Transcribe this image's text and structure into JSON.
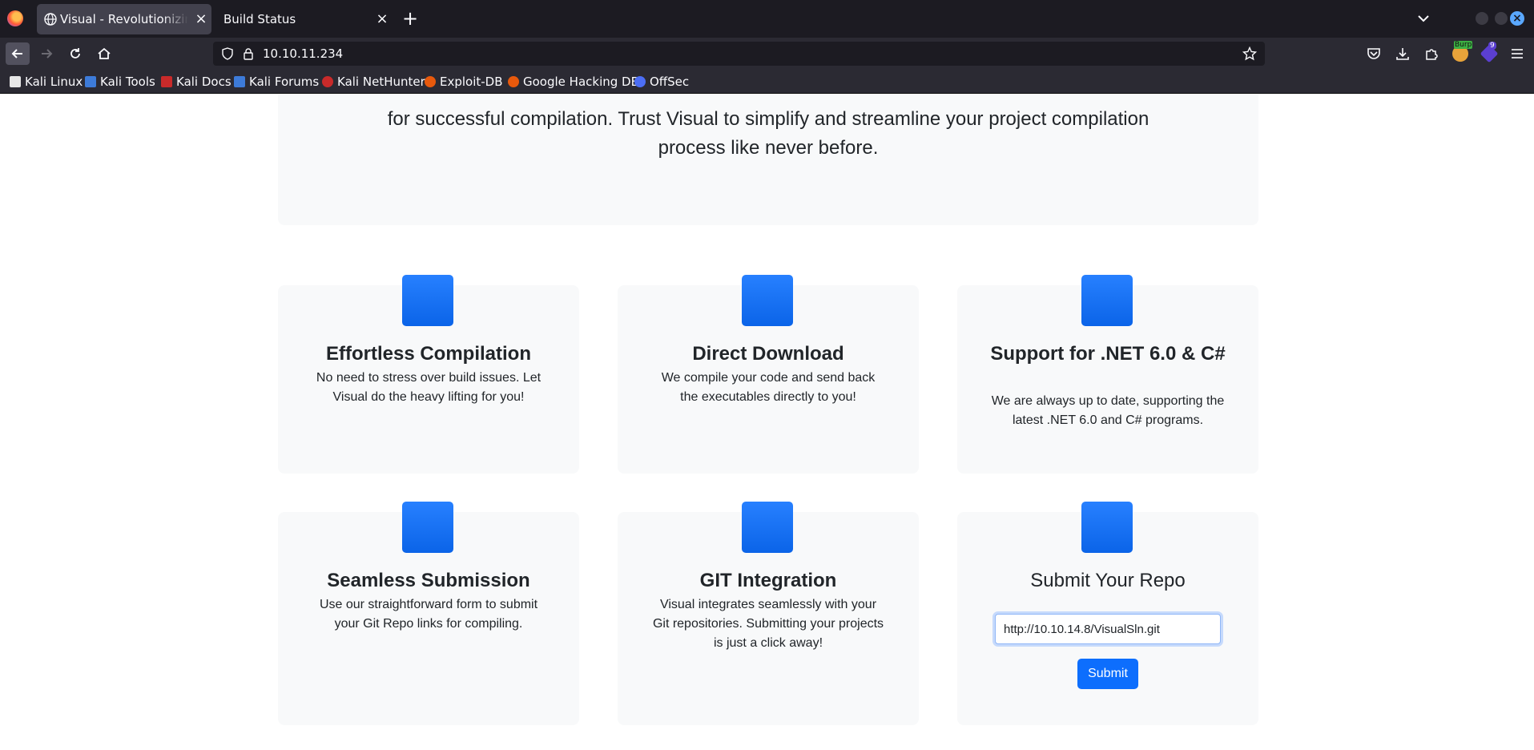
{
  "browser": {
    "tabs": [
      {
        "label": "Visual - Revolutionizing V",
        "active": true
      },
      {
        "label": "Build Status",
        "active": false
      }
    ],
    "url": "10.10.11.234",
    "bookmarks": [
      {
        "label": "Kali Linux",
        "icon": "kali-dragon-icon",
        "color": "#e6e6e6"
      },
      {
        "label": "Kali Tools",
        "icon": "kali-tools-icon",
        "color": "#3d7bd9"
      },
      {
        "label": "Kali Docs",
        "icon": "kali-docs-icon",
        "color": "#c92a2a"
      },
      {
        "label": "Kali Forums",
        "icon": "kali-forums-icon",
        "color": "#3d7bd9"
      },
      {
        "label": "Kali NetHunter",
        "icon": "nethunter-icon",
        "color": "#c92a2a"
      },
      {
        "label": "Exploit-DB",
        "icon": "exploit-db-icon",
        "color": "#e8590c"
      },
      {
        "label": "Google Hacking DB",
        "icon": "ghdb-icon",
        "color": "#e8590c"
      },
      {
        "label": "OffSec",
        "icon": "offsec-icon",
        "color": "#4c6ef5"
      }
    ],
    "extension_badges": {
      "burp": "Burp",
      "count": "9"
    }
  },
  "hero": {
    "text_line1": "for successful compilation. Trust Visual to simplify and streamline your project compilation",
    "text_line2": "process like never before."
  },
  "features": [
    {
      "title": "Effortless Compilation",
      "text": "No need to stress over build issues. Let Visual do the heavy lifting for you!"
    },
    {
      "title": "Direct Download",
      "text": "We compile your code and send back the executables directly to you!"
    },
    {
      "title": "Support for .NET 6.0 & C#",
      "text": "We are always up to date, supporting the latest .NET 6.0 and C# programs."
    },
    {
      "title": "Seamless Submission",
      "text": "Use our straightforward form to submit your Git Repo links for compiling."
    },
    {
      "title": "GIT Integration",
      "text": "Visual integrates seamlessly with your Git repositories. Submitting your projects is just a click away!"
    }
  ],
  "submit": {
    "title": "Submit Your Repo",
    "input_value": "http://10.10.14.8/VisualSln.git",
    "button_label": "Submit"
  },
  "colors": {
    "primary": "#0d6efd",
    "card_bg": "#f8f9fa",
    "text": "#212529"
  }
}
